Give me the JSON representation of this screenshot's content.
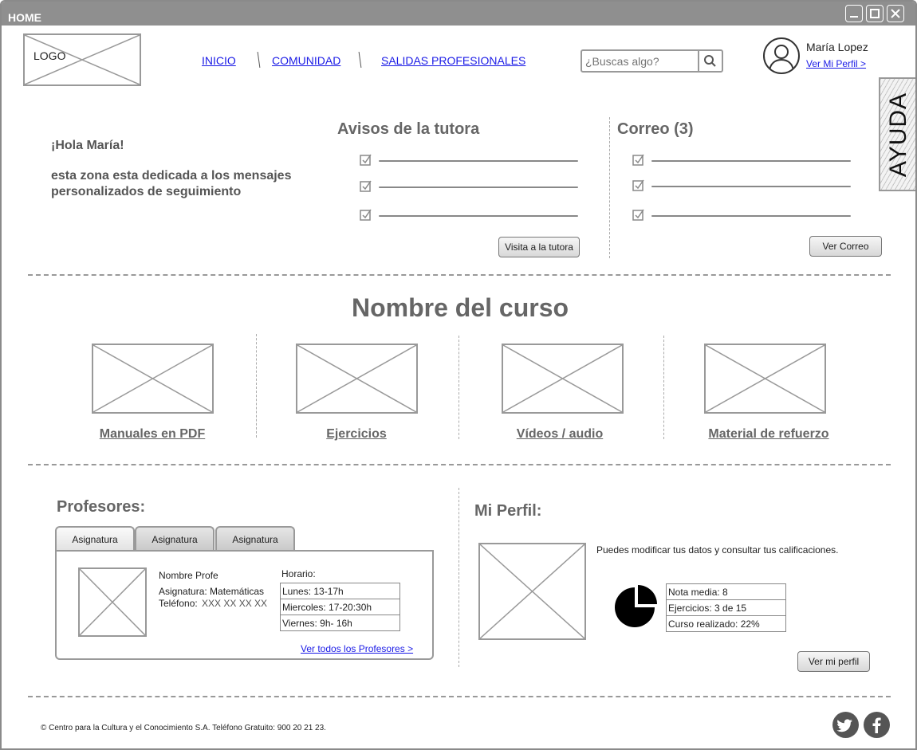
{
  "window": {
    "title": "HOME"
  },
  "header": {
    "logo_label": "LOGO",
    "nav": [
      {
        "label": "INICIO"
      },
      {
        "label": "COMUNIDAD"
      },
      {
        "label": "SALIDAS PROFESIONALES"
      }
    ],
    "search": {
      "placeholder": "¿Buscas algo?"
    },
    "user": {
      "name": "María Lopez",
      "profile_link": "Ver Mi Perfil >"
    }
  },
  "help_tab": {
    "label": "AYUDA"
  },
  "welcome": {
    "greeting": "¡Hola María!",
    "message": "esta zona esta dedicada a los mensajes personalizados de seguimiento"
  },
  "tutor_notices": {
    "title": "Avisos de la tutora",
    "button": "Visita a la tutora"
  },
  "mail": {
    "title": "Correo (3)",
    "button": "Ver Correo"
  },
  "course": {
    "title": "Nombre del curso",
    "resources": [
      {
        "label": "Manuales en PDF"
      },
      {
        "label": "Ejercicios"
      },
      {
        "label": "Vídeos / audio"
      },
      {
        "label": "Material de refuerzo"
      }
    ]
  },
  "teachers": {
    "title": "Profesores:",
    "tabs": [
      {
        "label": "Asignatura"
      },
      {
        "label": "Asignatura"
      },
      {
        "label": "Asignatura"
      }
    ],
    "card": {
      "name": "Nombre Profe",
      "subject": "Asignatura: Matemáticas",
      "phone_label": "Teléfono:",
      "phone_value": "XXX XX XX XX",
      "schedule_title": "Horario:",
      "schedule": [
        "Lunes: 13-17h",
        "Miercoles: 17-20:30h",
        "Viernes: 9h- 16h"
      ]
    },
    "all_link": "Ver todos los Profesores >"
  },
  "profile": {
    "title": "Mi Perfil:",
    "description": "Puedes modificar tus datos y consultar tus calificaciones.",
    "stats": [
      "Nota media: 8",
      "Ejercicios: 3 de 15",
      "Curso realizado: 22%"
    ],
    "progress_fraction": 0.75,
    "button": "Ver mi perfil"
  },
  "footer": {
    "copyright": "© Centro para la Cultura y el Conocimiento S.A. Teléfono Gratuito: 900 20 21 23.",
    "social": [
      "twitter-icon",
      "facebook-icon"
    ]
  }
}
